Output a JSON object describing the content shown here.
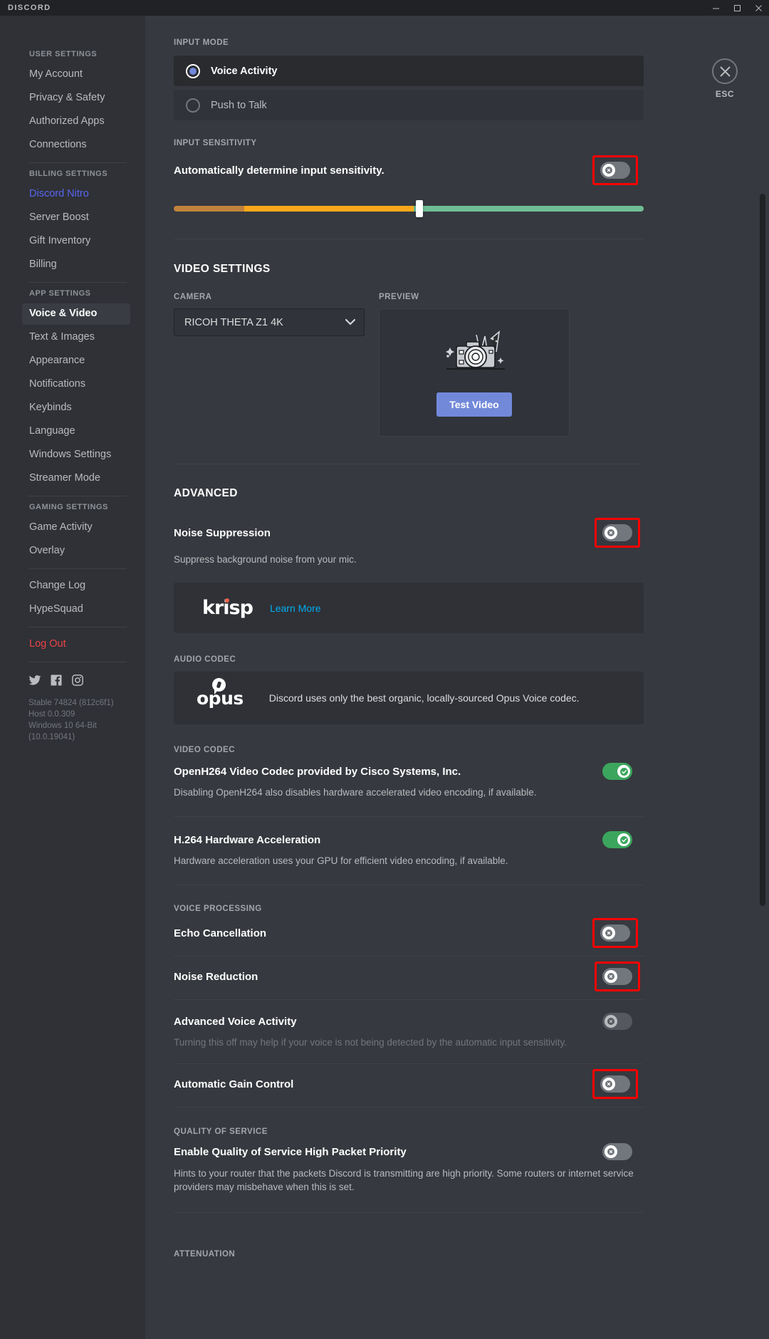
{
  "titlebar": {
    "brand": "DISCORD",
    "minimize_icon": "minimize-icon",
    "maximize_icon": "maximize-icon",
    "close_icon": "close-icon"
  },
  "sidebar": {
    "groups": [
      {
        "header": "USER SETTINGS",
        "items": [
          {
            "label": "My Account",
            "state": "normal"
          },
          {
            "label": "Privacy & Safety",
            "state": "normal"
          },
          {
            "label": "Authorized Apps",
            "state": "normal"
          },
          {
            "label": "Connections",
            "state": "normal"
          }
        ]
      },
      {
        "header": "BILLING SETTINGS",
        "items": [
          {
            "label": "Discord Nitro",
            "state": "nitro"
          },
          {
            "label": "Server Boost",
            "state": "normal"
          },
          {
            "label": "Gift Inventory",
            "state": "normal"
          },
          {
            "label": "Billing",
            "state": "normal"
          }
        ]
      },
      {
        "header": "APP SETTINGS",
        "items": [
          {
            "label": "Voice & Video",
            "state": "active"
          },
          {
            "label": "Text & Images",
            "state": "normal"
          },
          {
            "label": "Appearance",
            "state": "normal"
          },
          {
            "label": "Notifications",
            "state": "normal"
          },
          {
            "label": "Keybinds",
            "state": "normal"
          },
          {
            "label": "Language",
            "state": "normal"
          },
          {
            "label": "Windows Settings",
            "state": "normal"
          },
          {
            "label": "Streamer Mode",
            "state": "normal"
          }
        ]
      },
      {
        "header": "GAMING SETTINGS",
        "items": [
          {
            "label": "Game Activity",
            "state": "normal"
          },
          {
            "label": "Overlay",
            "state": "normal"
          }
        ]
      },
      {
        "header": "",
        "items": [
          {
            "label": "Change Log",
            "state": "normal"
          },
          {
            "label": "HypeSquad",
            "state": "normal"
          }
        ]
      },
      {
        "header": "",
        "items": [
          {
            "label": "Log Out",
            "state": "logout"
          }
        ]
      }
    ],
    "socials": [
      "twitter-icon",
      "facebook-icon",
      "instagram-icon"
    ],
    "version": {
      "build": "Stable 74824 (812c6f1)",
      "host": "Host 0.0.309",
      "os": "Windows 10 64-Bit (10.0.19041)"
    }
  },
  "esc": {
    "label": "ESC",
    "icon": "close-icon"
  },
  "main": {
    "input_mode": {
      "label": "INPUT MODE",
      "options": [
        {
          "label": "Voice Activity",
          "selected": true
        },
        {
          "label": "Push to Talk",
          "selected": false
        }
      ]
    },
    "input_sensitivity": {
      "label": "INPUT SENSITIVITY",
      "auto_label": "Automatically determine input sensitivity.",
      "auto_toggle": {
        "state": "off",
        "highlighted": true
      },
      "slider_value_percent": 51.5,
      "slider_colors": [
        "#c1833b",
        "#faa81a",
        "#6fbf95"
      ]
    },
    "video_settings": {
      "title": "VIDEO SETTINGS",
      "camera_label": "CAMERA",
      "camera_value": "RICOH THETA Z1 4K",
      "preview_label": "PREVIEW",
      "test_video_button": "Test Video",
      "camera_illustration_icon": "camera-illustration-icon"
    },
    "advanced": {
      "title": "ADVANCED",
      "noise_suppression": {
        "title": "Noise Suppression",
        "desc": "Suppress background noise from your mic.",
        "toggle": {
          "state": "off",
          "highlighted": true
        }
      },
      "krisp_card": {
        "logo": "krisp",
        "link": "Learn More"
      }
    },
    "audio_codec": {
      "label": "AUDIO CODEC",
      "logo": "opus",
      "text": "Discord uses only the best organic, locally-sourced Opus Voice codec."
    },
    "video_codec": {
      "label": "VIDEO CODEC",
      "rows": [
        {
          "title": "OpenH264 Video Codec provided by Cisco Systems, Inc.",
          "desc": "Disabling OpenH264 also disables hardware accelerated video encoding, if available.",
          "toggle": {
            "state": "on",
            "highlighted": false
          }
        },
        {
          "title": "H.264 Hardware Acceleration",
          "desc": "Hardware acceleration uses your GPU for efficient video encoding, if available.",
          "toggle": {
            "state": "on",
            "highlighted": false
          }
        }
      ]
    },
    "voice_processing": {
      "label": "VOICE PROCESSING",
      "rows": [
        {
          "title": "Echo Cancellation",
          "desc": "",
          "toggle": {
            "state": "off",
            "highlighted": true,
            "dim": false
          }
        },
        {
          "title": "Noise Reduction",
          "desc": "",
          "toggle": {
            "state": "off",
            "highlighted": true,
            "dim": false
          }
        },
        {
          "title": "Advanced Voice Activity",
          "desc": "Turning this off may help if your voice is not being detected by the automatic input sensitivity.",
          "toggle": {
            "state": "off",
            "highlighted": false,
            "dim": true
          }
        },
        {
          "title": "Automatic Gain Control",
          "desc": "",
          "toggle": {
            "state": "off",
            "highlighted": true,
            "dim": false
          }
        }
      ]
    },
    "quality_of_service": {
      "label": "QUALITY OF SERVICE",
      "title": "Enable Quality of Service High Packet Priority",
      "desc": "Hints to your router that the packets Discord is transmitting are high priority. Some routers or internet service providers may misbehave when this is set.",
      "toggle": {
        "state": "off",
        "highlighted": false
      }
    },
    "attenuation": {
      "label": "ATTENUATION"
    }
  },
  "colors": {
    "accent": "#7289da",
    "nitro": "#5865f2",
    "danger": "#ed4245",
    "link": "#00aff4",
    "toggle_on": "#3ba55d",
    "toggle_off": "#72767d",
    "highlight": "#ff0000"
  }
}
